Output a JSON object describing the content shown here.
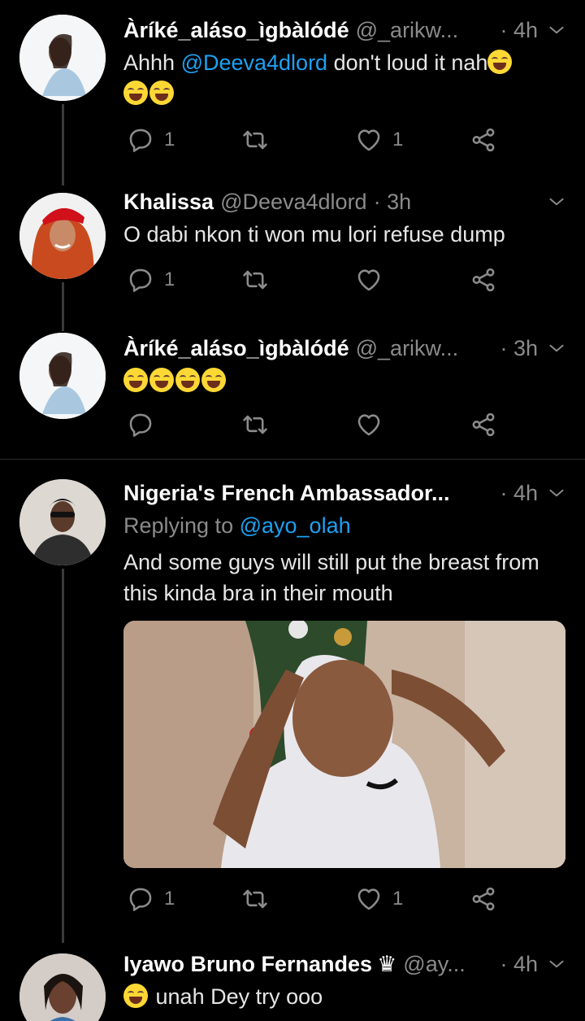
{
  "tweets": [
    {
      "name": "Àríké_aláso_ìgbàlódé",
      "handle": "@_arikw...",
      "time": "· 4h",
      "text_prefix": "Ahhh ",
      "mention": "@Deeva4dlord",
      "text_suffix": " don't loud it nah",
      "emoji_count": 3,
      "reply_count": "1",
      "retweet_count": "",
      "like_count": "1"
    },
    {
      "name": "Khalissa",
      "handle": "@Deeva4dlord",
      "time": "· 3h",
      "text": "O dabi nkon ti won mu lori refuse dump",
      "reply_count": "1",
      "retweet_count": "",
      "like_count": ""
    },
    {
      "name": "Àríké_aláso_ìgbàlódé",
      "handle": "@_arikw...",
      "time": "· 3h",
      "emoji_count": 4,
      "reply_count": "",
      "retweet_count": "",
      "like_count": ""
    },
    {
      "name": "Nigeria's French Ambassador...",
      "handle": "",
      "time": "· 4h",
      "replying_label": "Replying to ",
      "replying_handle": "@ayo_olah",
      "text": "And some guys will still put the breast from this kinda bra in their mouth",
      "reply_count": "1",
      "retweet_count": "",
      "like_count": "1"
    },
    {
      "name": "Iyawo Bruno Fernandes",
      "badge": "♛",
      "handle": "@ay...",
      "time": "· 4h",
      "text": "unah Dey try ooo"
    }
  ],
  "icons": {
    "reply": "reply-icon",
    "retweet": "retweet-icon",
    "like": "heart-icon",
    "share": "share-icon",
    "more": "chevron-down-icon"
  },
  "colors": {
    "background": "#000000",
    "link": "#1da1f2",
    "muted": "#8b8b8b"
  }
}
